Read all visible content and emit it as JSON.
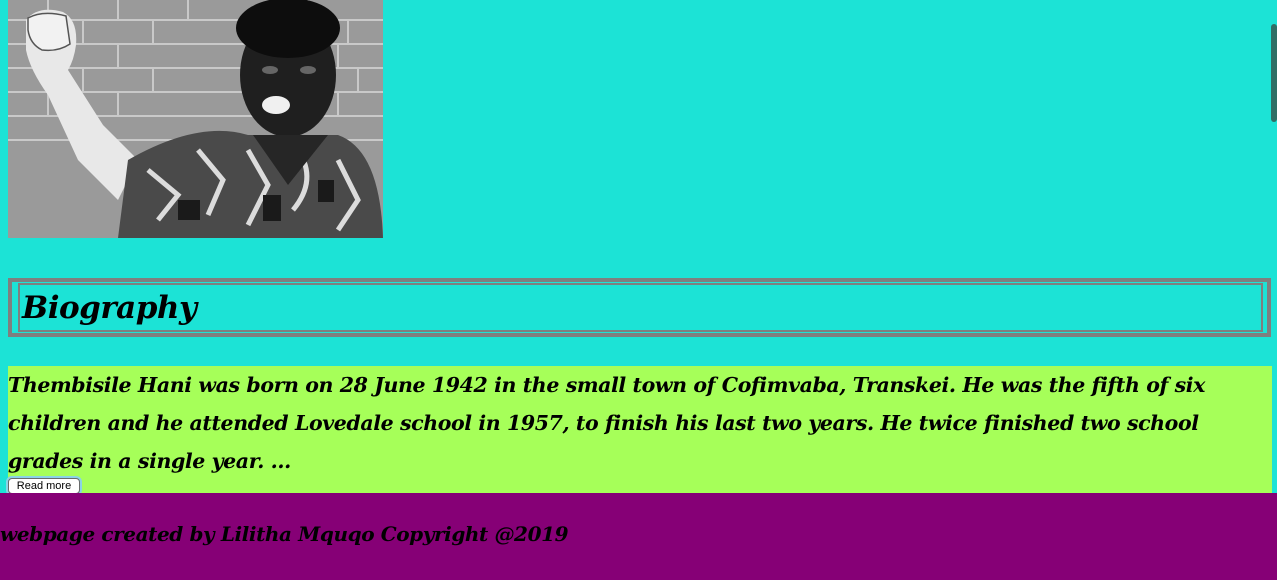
{
  "colors": {
    "page_background": "#1ce3d6",
    "biography_box_border": "#7f7f7f",
    "paragraph_background": "#a6ff59",
    "footer_background": "#860076",
    "text": "#000000"
  },
  "photo": {
    "icon": "portrait-photo-icon"
  },
  "biography": {
    "title": "Biography",
    "text": "Thembisile Hani was born on 28 June 1942 in the small town of Cofimvaba, Transkei. He was the fifth of six children and he attended Lovedale school in 1957, to finish his last two years. He twice finished two school grades in a single year. ...",
    "read_more_label": "Read more"
  },
  "footer": {
    "text": "webpage created by Lilitha Mquqo Copyright @2019"
  }
}
